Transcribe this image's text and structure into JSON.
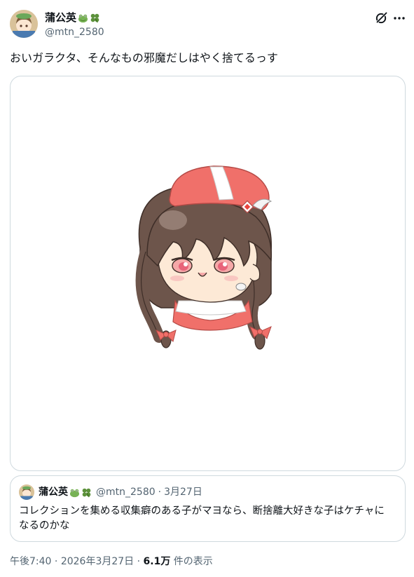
{
  "author": {
    "display_name": "蒲公英",
    "badges": [
      "frog-emoji",
      "four-leaf-clover-emoji"
    ],
    "handle": "@mtn_2580"
  },
  "tweet": {
    "text": "おいガラクタ、そんなもの邪魔だしはやく捨てるっす"
  },
  "quoted_tweet": {
    "display_name": "蒲公英",
    "handle": "@mtn_2580",
    "separator": "·",
    "date": "3月27日",
    "text_line1": "コレクションを集める収集癖のある子がマヨなら、断捨離大好きな子はケチャに",
    "text_line2": "なるのかな"
  },
  "meta": {
    "time": "午後7:40",
    "separator": "·",
    "date": "2026年3月27日",
    "separator2": "·",
    "views_count": "6.1万",
    "views_label": "件の表示"
  },
  "colors": {
    "text_primary": "#0f1419",
    "text_secondary": "#536471",
    "border": "#cfd9de",
    "hat_red": "#f0706a",
    "hair_brown": "#6d554b"
  },
  "icons": {
    "grok": "grok-icon",
    "more": "more-icon"
  }
}
